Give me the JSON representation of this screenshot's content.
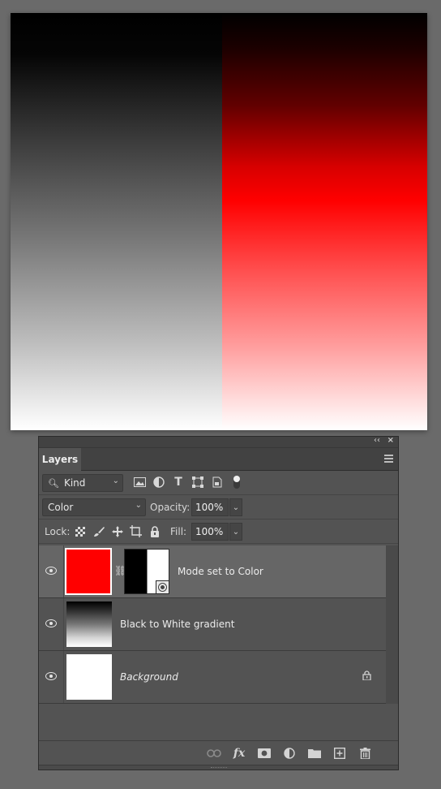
{
  "panel": {
    "tab_label": "Layers",
    "collapse_glyph": "‹‹",
    "close_glyph": "×"
  },
  "filter": {
    "kind_label": "Kind",
    "icons": [
      "image-filter-icon",
      "adjustment-filter-icon",
      "type-filter-icon",
      "shape-filter-icon",
      "smart-object-filter-icon",
      "filter-toggle-icon"
    ]
  },
  "blend": {
    "mode": "Color",
    "opacity_label": "Opacity:",
    "opacity_value": "100%"
  },
  "lock": {
    "label": "Lock:",
    "fill_label": "Fill:",
    "fill_value": "100%"
  },
  "layers": [
    {
      "name": "Mode set to Color",
      "visible": true,
      "selected": true,
      "has_mask": true,
      "thumb_color": "#ff0000"
    },
    {
      "name": "Black to White gradient",
      "visible": true,
      "selected": false,
      "has_mask": false
    },
    {
      "name": "Background",
      "visible": true,
      "selected": false,
      "locked": true,
      "italic": true
    }
  ],
  "bottom_bar": {
    "icons": [
      "link-layers-icon",
      "fx-icon",
      "add-mask-icon",
      "adjustment-layer-icon",
      "new-group-icon",
      "new-layer-icon",
      "delete-layer-icon"
    ],
    "fx_label": "fx"
  },
  "colors": {
    "workspace_bg": "#6a6a6a",
    "panel_bg": "#535353",
    "selected_row": "#666666",
    "layer_red": "#ff0000"
  }
}
